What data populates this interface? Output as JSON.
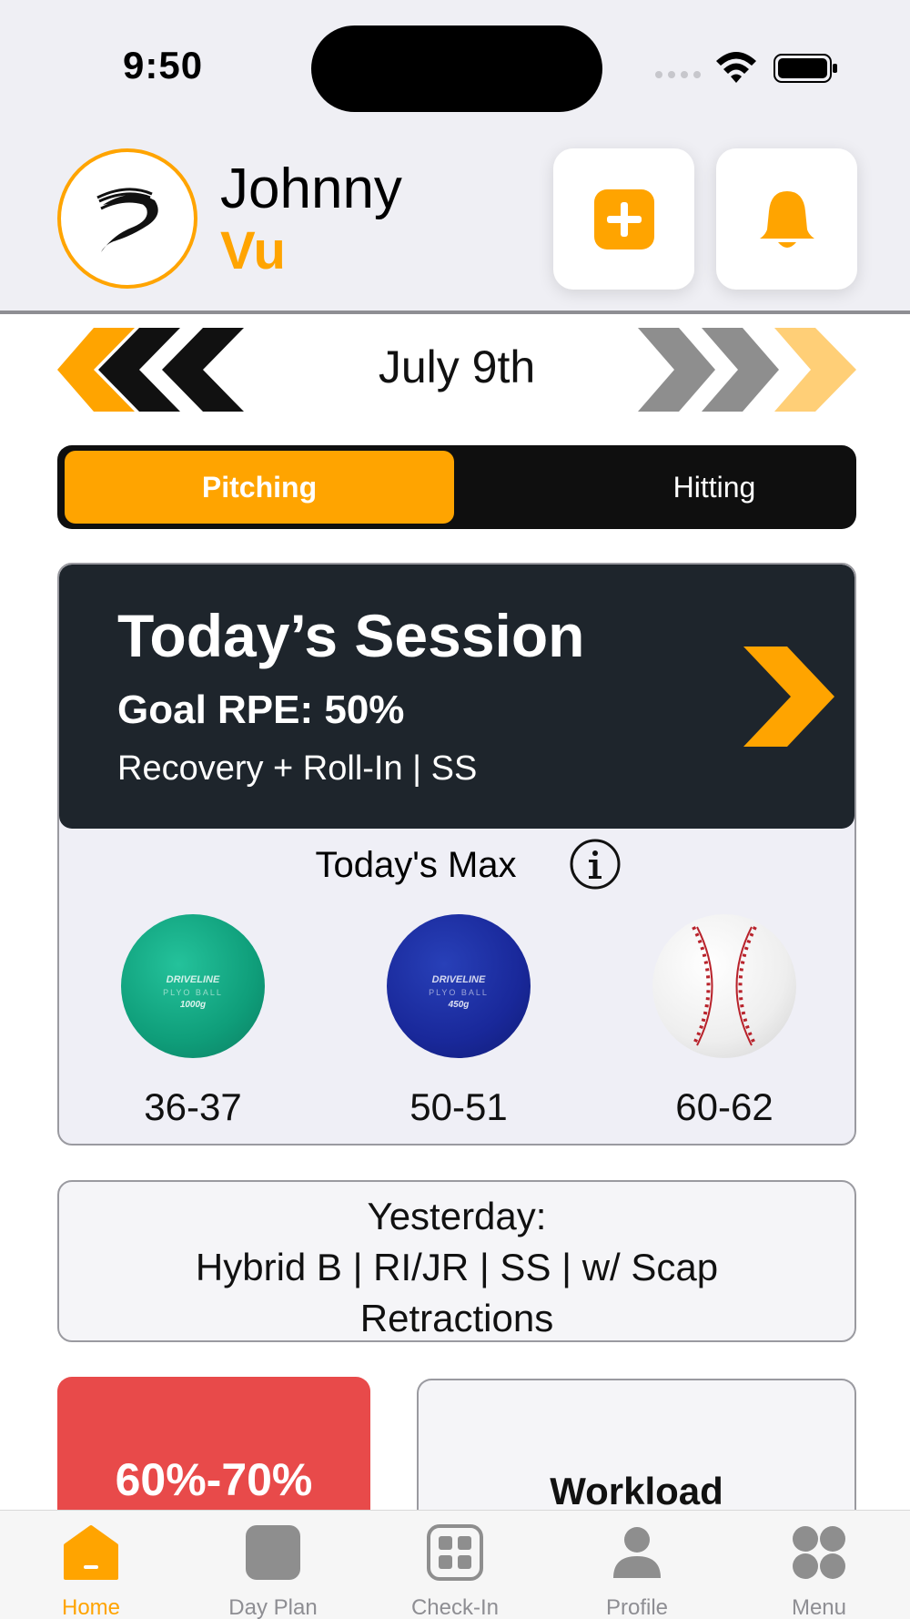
{
  "status_bar": {
    "time": "9:50"
  },
  "header": {
    "first_name": "Johnny",
    "last_name": "Vu",
    "add_button": "plus-icon",
    "notifications_button": "bell-icon"
  },
  "date_nav": {
    "label": "July 9th"
  },
  "segmented": {
    "options": [
      "Pitching",
      "Hitting"
    ],
    "selected": "Pitching"
  },
  "session": {
    "title": "Today’s Session",
    "goal": "Goal RPE: 50%",
    "subtitle": "Recovery + Roll-In | SS",
    "max_title": "Today's Max",
    "balls": [
      {
        "brand": "DRIVELINE",
        "type": "PLYO BALL",
        "weight": "1000g",
        "velo": "36-37",
        "color": "#14a985"
      },
      {
        "brand": "DRIVELINE",
        "type": "PLYO BALL",
        "weight": "450g",
        "velo": "50-51",
        "color": "#1b2a9e"
      },
      {
        "brand": "",
        "type": "",
        "weight": "",
        "velo": "60-62",
        "color": "#ffffff"
      }
    ]
  },
  "yesterday": {
    "line1": "Yesterday:",
    "line2": "Hybrid B | RI/JR | SS | w/ Scap",
    "line3": "Retractions"
  },
  "cards": {
    "rpe_range": "60%-70%",
    "workload": "Workload"
  },
  "tabbar": {
    "items": [
      {
        "label": "Home",
        "icon": "home-icon",
        "active": true
      },
      {
        "label": "Day Plan",
        "icon": "day-plan-icon",
        "active": false
      },
      {
        "label": "Check-In",
        "icon": "check-in-icon",
        "active": false
      },
      {
        "label": "Profile",
        "icon": "profile-icon",
        "active": false
      },
      {
        "label": "Menu",
        "icon": "menu-icon",
        "active": false
      }
    ]
  },
  "colors": {
    "accent": "#ffa400",
    "dark": "#1e252c",
    "danger": "#e84a4a"
  }
}
